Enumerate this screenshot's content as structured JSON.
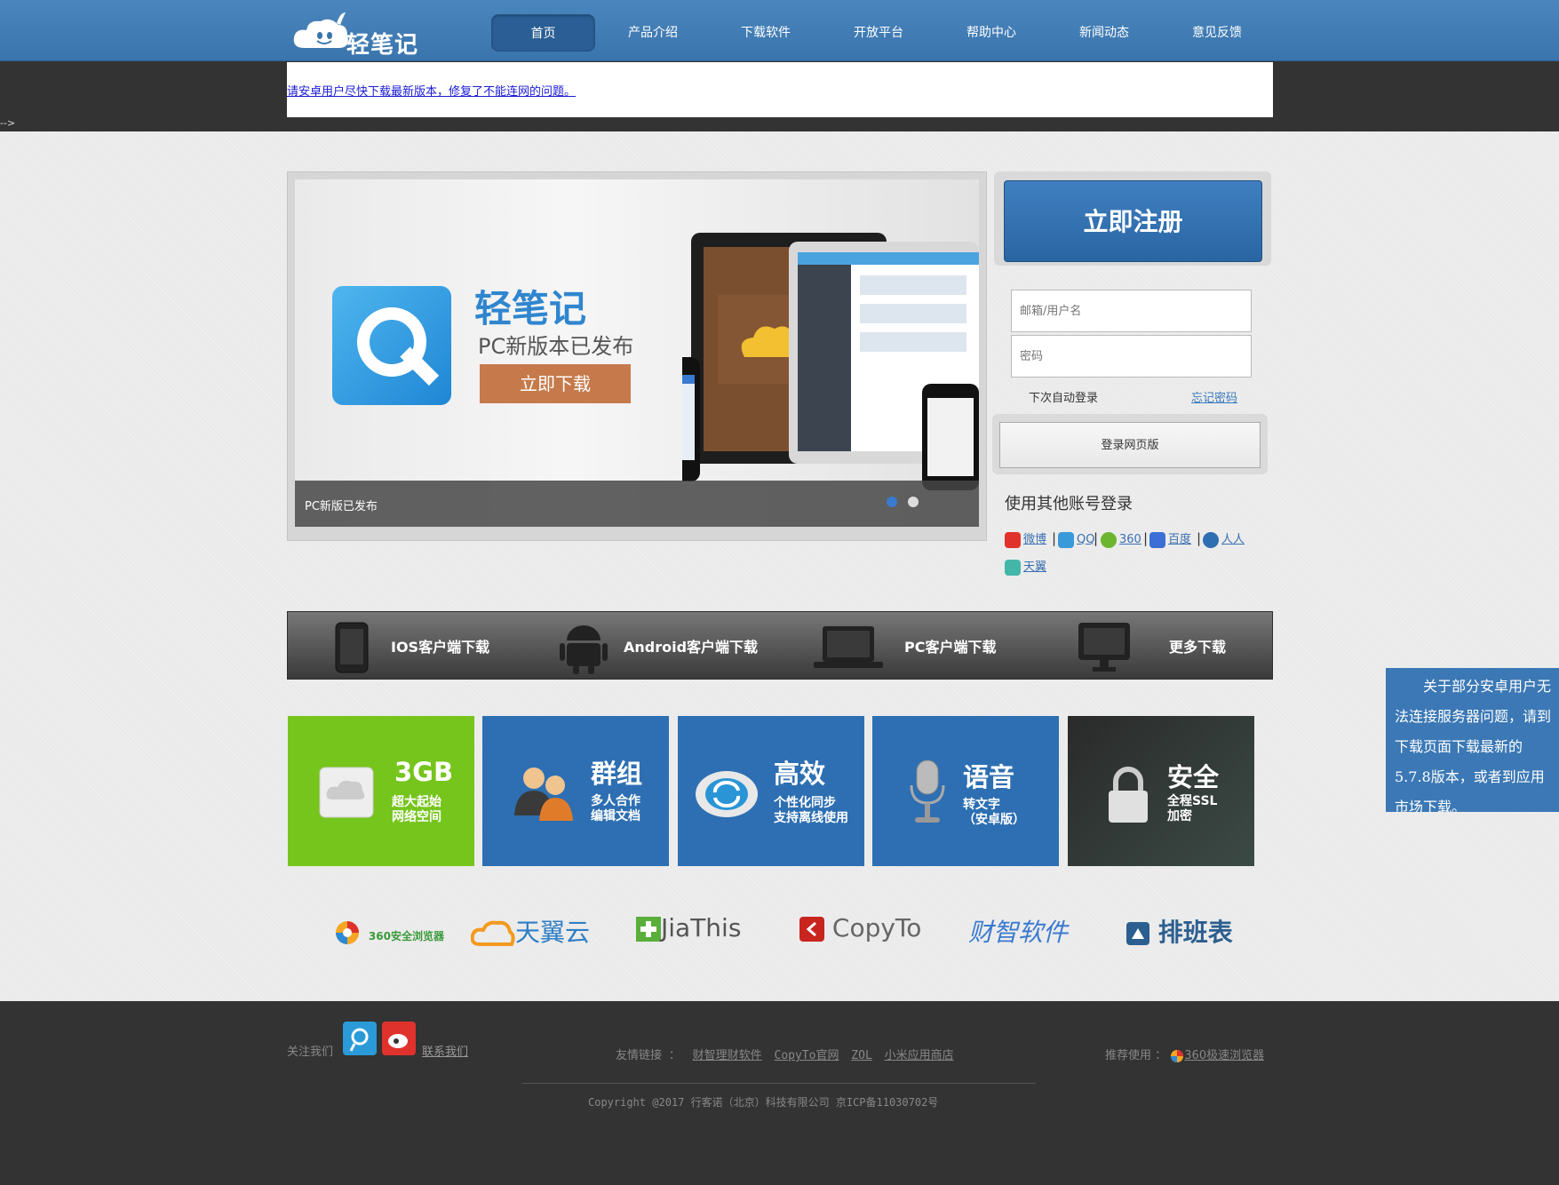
{
  "header": {
    "logo_text": "轻笔记",
    "nav": [
      {
        "label": "首页",
        "active": true
      },
      {
        "label": "产品介绍"
      },
      {
        "label": "下载软件"
      },
      {
        "label": "开放平台"
      },
      {
        "label": "帮助中心"
      },
      {
        "label": "新闻动态"
      },
      {
        "label": "意见反馈"
      }
    ]
  },
  "notice": {
    "text": "请安卓用户尽快下载最新版本，修复了不能连网的问题。"
  },
  "stray_text": "-->",
  "banner": {
    "title": "轻笔记",
    "subtitle": "PC新版本已发布",
    "button_label": "立即下载",
    "caption": "PC新版已发布",
    "slides": 2,
    "active_slide": 1
  },
  "login": {
    "register_label": "立即注册",
    "username_placeholder": "邮箱/用户名",
    "password_placeholder": "密码",
    "remember_label": "下次自动登录",
    "forgot_label": "忘记密码",
    "login_label": "登录网页版",
    "other_title": "使用其他账号登录",
    "social": [
      "微博",
      "QQ",
      "360",
      "百度",
      "人人",
      "天翼"
    ]
  },
  "downloads": [
    {
      "label": "IOS客户端下载",
      "icon": "phone-icon"
    },
    {
      "label": "Android客户端下载",
      "icon": "android-icon"
    },
    {
      "label": "PC客户端下载",
      "icon": "laptop-icon"
    },
    {
      "label": "更多下载",
      "icon": "monitor-icon"
    }
  ],
  "features": [
    {
      "title": "3GB",
      "lines": [
        "超大起始",
        "网络空间"
      ],
      "color": "#76c51d",
      "icon": "cloud-drive-icon"
    },
    {
      "title": "群组",
      "lines": [
        "多人合作",
        "编辑文档"
      ],
      "color": "#2d6fb2",
      "icon": "group-icon"
    },
    {
      "title": "高效",
      "lines": [
        "个性化同步",
        "支持离线使用"
      ],
      "color": "#2d6fb2",
      "icon": "sync-icon"
    },
    {
      "title": "语音",
      "lines": [
        "转文字",
        "（安卓版）"
      ],
      "color": "#2d6fb2",
      "icon": "microphone-icon"
    },
    {
      "title": "安全",
      "lines": [
        "全程SSL",
        "加密"
      ],
      "color": "#2a2a2a",
      "icon": "lock-icon"
    }
  ],
  "partners": [
    "360安全浏览器",
    "天翼云",
    "JiaThis",
    "CopyTo",
    "财智软件",
    "排班表"
  ],
  "footer": {
    "follow_label": "关注我们",
    "contact_label": "联系我们",
    "links_label": "友情链接 ：",
    "links": [
      "财智理财软件",
      "CopyTo官网",
      "ZOL",
      "小米应用商店"
    ],
    "recommend_label": "推荐使用 ：",
    "recommend_link": "360极速浏览器",
    "copyright": "Copyright @2017 行客诺（北京）科技有限公司 京ICP备11030702号"
  },
  "float_notice": {
    "text": "关于部分安卓用户无法连接服务器问题，请到下载页面下载最新的5.7.8版本，或者到应用市场下载。"
  }
}
